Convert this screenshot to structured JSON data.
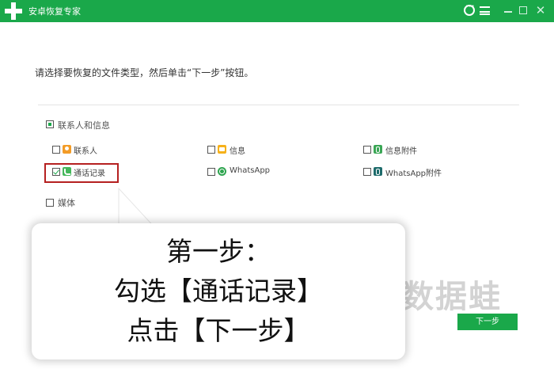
{
  "window": {
    "title": "安卓恢复专家",
    "minimize_glyph": "—",
    "close_glyph": "✕"
  },
  "main": {
    "instruction": "请选择要恢复的文件类型，然后单击“下一步”按钮。",
    "groups": [
      {
        "label": "联系人和信息",
        "state": "partial",
        "items": [
          {
            "label": "联系人",
            "checked": false,
            "icon": "contacts-icon"
          },
          {
            "label": "信息",
            "checked": false,
            "icon": "messages-icon"
          },
          {
            "label": "信息附件",
            "checked": false,
            "icon": "attachment-icon"
          },
          {
            "label": "通话记录",
            "checked": true,
            "icon": "call-log-icon"
          },
          {
            "label": "WhatsApp",
            "checked": false,
            "icon": "whatsapp-icon"
          },
          {
            "label": "WhatsApp附件",
            "checked": false,
            "icon": "whatsapp-attachment-icon"
          }
        ]
      },
      {
        "label": "媒体",
        "state": "unchecked"
      }
    ],
    "next_button": "下一步"
  },
  "callout": {
    "line1": "第一步：",
    "line2": "勾选【通话记录】",
    "line3": "点击【下一步】"
  },
  "watermark": "数据蛙",
  "colors": {
    "brand_green": "#1aa84a",
    "highlight_red": "#b52020"
  }
}
